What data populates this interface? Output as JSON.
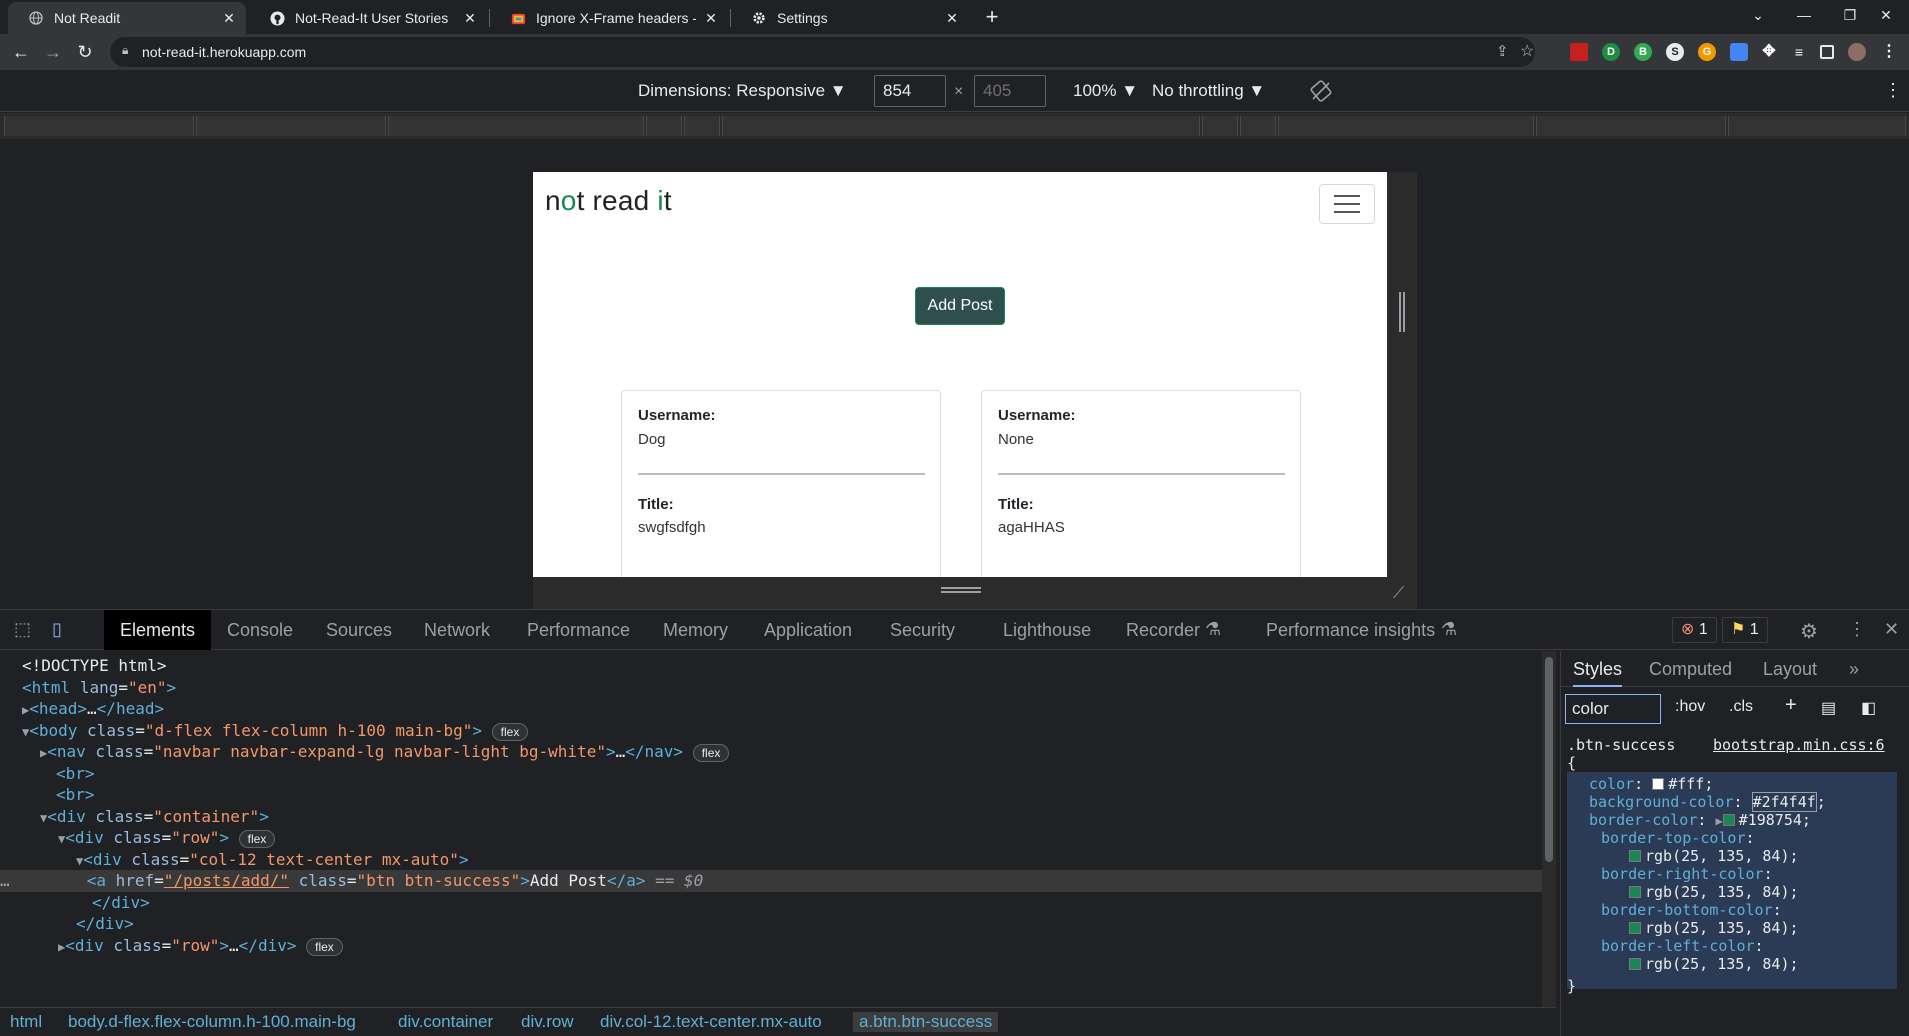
{
  "browser": {
    "tabs": [
      {
        "title": "Not Readit",
        "icon": "globe-icon"
      },
      {
        "title": "Not-Read-It User Stories",
        "icon": "github-icon"
      },
      {
        "title": "Ignore X-Frame headers - Chrom",
        "icon": "extension-icon"
      },
      {
        "title": "Settings",
        "icon": "gear-icon"
      }
    ],
    "url": "not-read-it.herokuapp.com"
  },
  "device_toolbar": {
    "dimensions_label": "Dimensions: Responsive ▼",
    "width": "854",
    "height": "405",
    "zoom": "100% ▼",
    "throttling": "No throttling ▼"
  },
  "page": {
    "brand_prefix": "n",
    "brand_o": "o",
    "brand_mid": "t read ",
    "brand_i": "i",
    "brand_suffix": "t",
    "add_post_label": "Add Post",
    "cards": [
      {
        "username_label": "Username:",
        "username": "Dog",
        "title_label": "Title:",
        "title": "swgfsdfgh"
      },
      {
        "username_label": "Username:",
        "username": "None",
        "title_label": "Title:",
        "title": "agaHHAS"
      }
    ]
  },
  "devtools": {
    "tabs": [
      "Elements",
      "Console",
      "Sources",
      "Network",
      "Performance",
      "Memory",
      "Application",
      "Security",
      "Lighthouse",
      "Recorder",
      "Performance insights"
    ],
    "errors": "1",
    "warnings": "1",
    "breadcrumbs": [
      "html",
      "body.d-flex.flex-column.h-100.main-bg",
      "div.container",
      "div.row",
      "div.col-12.text-center.mx-auto",
      "a.btn.btn-success"
    ],
    "styles": {
      "tabs": [
        "Styles",
        "Computed",
        "Layout"
      ],
      "filter": "color",
      "hov": ":hov",
      "cls": ".cls",
      "selector": ".btn-success",
      "source": "bootstrap.min.css:6",
      "color_value": "#fff",
      "background_value": "#2f4f4f",
      "border_value": "#198754",
      "rgb_value": "rgb(25, 135, 84);"
    }
  },
  "colors": {
    "accent_green": "#198754",
    "button_bg": "#2f4f4f"
  }
}
